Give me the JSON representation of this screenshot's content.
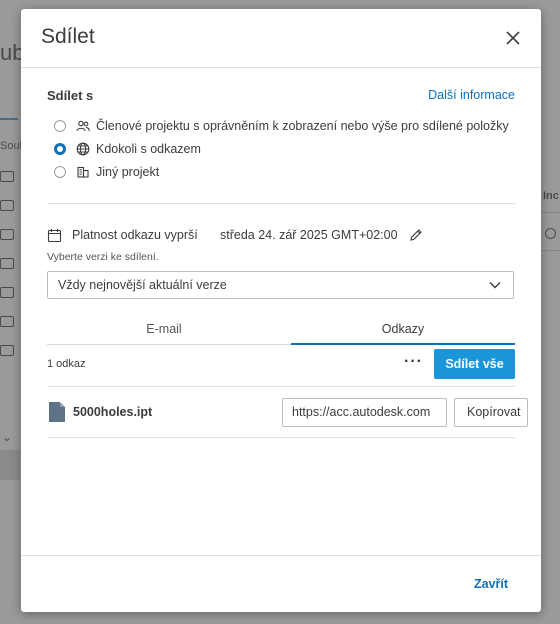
{
  "background": {
    "heading_partial": "ub",
    "sidebar_partial": "Soul",
    "column_partial": "Inc"
  },
  "dialog": {
    "title": "Sdílet",
    "close_icon": "close-icon",
    "share_with_label": "Sdílet s",
    "more_info_link": "Další informace",
    "options": [
      {
        "label": "Členové projektu s oprávněním k zobrazení nebo výše pro sdílené položky",
        "icon": "people-icon",
        "checked": false
      },
      {
        "label": "Kdokoli s odkazem",
        "icon": "globe-icon",
        "checked": true
      },
      {
        "label": "Jiný projekt",
        "icon": "project-icon",
        "checked": false
      }
    ],
    "expiry": {
      "label": "Platnost odkazu vyprší",
      "value": "středa 24. zář 2025 GMT+02:00"
    },
    "version_hint": "Vyberte verzi ke sdílení.",
    "version_select": "Vždy nejnovější aktuální verze",
    "tabs": [
      {
        "label": "E-mail",
        "active": false
      },
      {
        "label": "Odkazy",
        "active": true
      }
    ],
    "link_count": "1 odkaz",
    "more_actions": "···",
    "share_all_button": "Sdílet vše",
    "file": {
      "name": "5000holes.ipt",
      "url": "https://acc.autodesk.com",
      "copy_button": "Kopírovat"
    },
    "footer_close": "Zavřít"
  },
  "colors": {
    "accent": "#0f70b7",
    "primary_button": "#1a95d8",
    "overlay": "#9a9a9a"
  }
}
